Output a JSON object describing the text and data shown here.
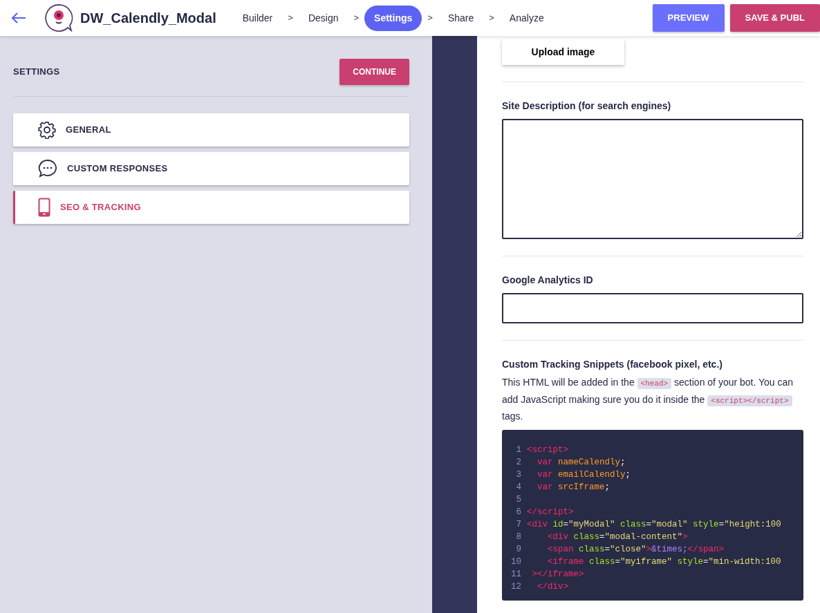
{
  "header": {
    "title": "DW_Calendly_Modal",
    "steps": [
      {
        "label": "Builder",
        "selected": false
      },
      {
        "label": "Design",
        "selected": false
      },
      {
        "label": "Settings",
        "selected": true
      },
      {
        "label": "Share",
        "selected": false
      },
      {
        "label": "Analyze",
        "selected": false
      }
    ],
    "separator": ">",
    "buttons": [
      {
        "label": "PREVIEW",
        "kind": "preview"
      },
      {
        "label": "SAVE & PUBL",
        "kind": "save"
      }
    ]
  },
  "sidebar": {
    "title": "SETTINGS",
    "continue": "CONTINUE",
    "items": [
      {
        "label": "GENERAL",
        "selected": false
      },
      {
        "label": "CUSTOM RESPONSES",
        "selected": false
      },
      {
        "label": "SEO & TRACKING",
        "selected": true
      }
    ]
  },
  "form": {
    "upload": "Upload image",
    "description_label": "Site Description (for search engines)",
    "analytics_label": "Google Analytics ID",
    "snippets_label": "Custom Tracking Snippets (facebook pixel, etc.)",
    "snippets_help": [
      {
        "kind": "text",
        "text": "This HTML will be added in the"
      },
      {
        "kind": "code",
        "text": "<head>"
      },
      {
        "kind": "text",
        "text": "section of your bot. You can add JavaScript making sure you do it inside the"
      },
      {
        "kind": "code",
        "text": "<script></script>"
      },
      {
        "kind": "text",
        "text": "tags."
      }
    ],
    "code": [
      {
        "number": "1",
        "tokens": [
          {
            "kind": "tag",
            "text": "<script>"
          }
        ]
      },
      {
        "number": "2",
        "tokens": [
          {
            "kind": "keyword",
            "text": "  var "
          },
          {
            "kind": "name",
            "text": "nameCalendly"
          },
          {
            "kind": "plain",
            "text": ";"
          }
        ]
      },
      {
        "number": "3",
        "tokens": [
          {
            "kind": "keyword",
            "text": "  var "
          },
          {
            "kind": "name",
            "text": "emailCalendly"
          },
          {
            "kind": "plain",
            "text": ";"
          }
        ]
      },
      {
        "number": "4",
        "tokens": [
          {
            "kind": "keyword",
            "text": "  var "
          },
          {
            "kind": "name",
            "text": "srcIframe"
          },
          {
            "kind": "plain",
            "text": ";"
          }
        ]
      },
      {
        "number": "5"
      },
      {
        "number": "6",
        "tokens": [
          {
            "kind": "tag",
            "text": "</script>"
          }
        ]
      },
      {
        "number": "7",
        "tokens": [
          {
            "kind": "tag",
            "text": "<div "
          },
          {
            "kind": "attr",
            "text": "id"
          },
          {
            "kind": "plain",
            "text": "="
          },
          {
            "kind": "string",
            "text": "\"myModal\" "
          },
          {
            "kind": "attr",
            "text": "class"
          },
          {
            "kind": "plain",
            "text": "="
          },
          {
            "kind": "string",
            "text": "\"modal\" "
          },
          {
            "kind": "attr",
            "text": "style"
          },
          {
            "kind": "plain",
            "text": "="
          },
          {
            "kind": "string",
            "text": "\"height:100"
          }
        ]
      },
      {
        "number": "8",
        "tokens": [
          {
            "kind": "tag",
            "text": "    <div "
          },
          {
            "kind": "attr",
            "text": "class"
          },
          {
            "kind": "plain",
            "text": "="
          },
          {
            "kind": "string",
            "text": "\"modal-content\""
          },
          {
            "kind": "tag",
            "text": ">"
          }
        ]
      },
      {
        "number": "9",
        "tokens": [
          {
            "kind": "tag",
            "text": "    <span "
          },
          {
            "kind": "attr",
            "text": "class"
          },
          {
            "kind": "plain",
            "text": "="
          },
          {
            "kind": "string",
            "text": "\"close\""
          },
          {
            "kind": "tag",
            "text": ">"
          },
          {
            "kind": "entity",
            "text": "&times;"
          },
          {
            "kind": "tag",
            "text": "</span>"
          }
        ]
      },
      {
        "number": "10",
        "tokens": [
          {
            "kind": "tag",
            "text": "    <iframe "
          },
          {
            "kind": "attr",
            "text": "class"
          },
          {
            "kind": "plain",
            "text": "="
          },
          {
            "kind": "string",
            "text": "\"myiframe\" "
          },
          {
            "kind": "attr",
            "text": "style"
          },
          {
            "kind": "plain",
            "text": "="
          },
          {
            "kind": "string",
            "text": "\"min-width:100"
          }
        ]
      },
      {
        "number": "11",
        "tokens": [
          {
            "kind": "tag",
            "text": " ></iframe>"
          }
        ]
      },
      {
        "number": "12",
        "tokens": [
          {
            "kind": "tag",
            "text": "  </div>"
          }
        ]
      }
    ]
  }
}
